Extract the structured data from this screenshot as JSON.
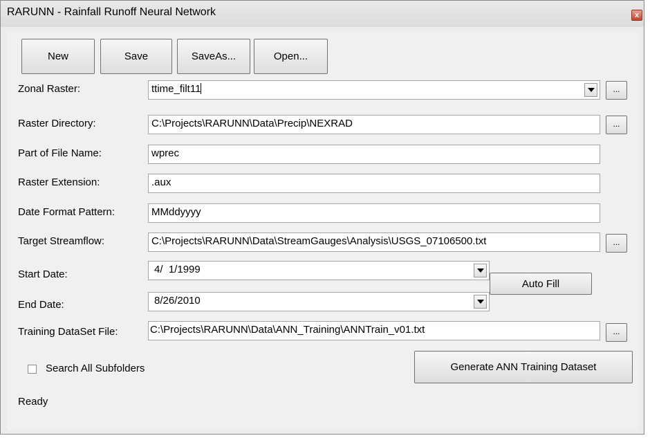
{
  "window": {
    "title": "RARUNN - Rainfall Runoff Neural Network",
    "close_glyph": "x"
  },
  "toolbar": {
    "new_label": "New",
    "save_label": "Save",
    "saveas_label": "SaveAs...",
    "open_label": "Open..."
  },
  "fields": {
    "zonal_raster": {
      "label": "Zonal Raster:",
      "value": "ttime_filt11"
    },
    "raster_directory": {
      "label": "Raster Directory:",
      "value": "C:\\Projects\\RARUNN\\Data\\Precip\\NEXRAD"
    },
    "part_of_file_name": {
      "label": "Part of File Name:",
      "value": "wprec"
    },
    "raster_extension": {
      "label": "Raster Extension:",
      "value": ".aux"
    },
    "date_format_pattern": {
      "label": "Date Format Pattern:",
      "value": "MMddyyyy"
    },
    "target_streamflow": {
      "label": "Target Streamflow:",
      "value": "C:\\Projects\\RARUNN\\Data\\StreamGauges\\Analysis\\USGS_07106500.txt"
    },
    "start_date": {
      "label": "Start Date:",
      "value": "4/  1/1999"
    },
    "end_date": {
      "label": "End Date:",
      "value": "8/26/2010"
    },
    "training_dataset_file": {
      "label": "Training DataSet File:",
      "value": "C:\\Projects\\RARUNN\\Data\\ANN_Training\\ANNTrain_v01.txt"
    }
  },
  "browse_label": "...",
  "auto_fill_label": "Auto Fill",
  "search_subfolders": {
    "label": "Search All Subfolders",
    "checked": false
  },
  "generate_label": "Generate ANN Training Dataset",
  "status": "Ready"
}
